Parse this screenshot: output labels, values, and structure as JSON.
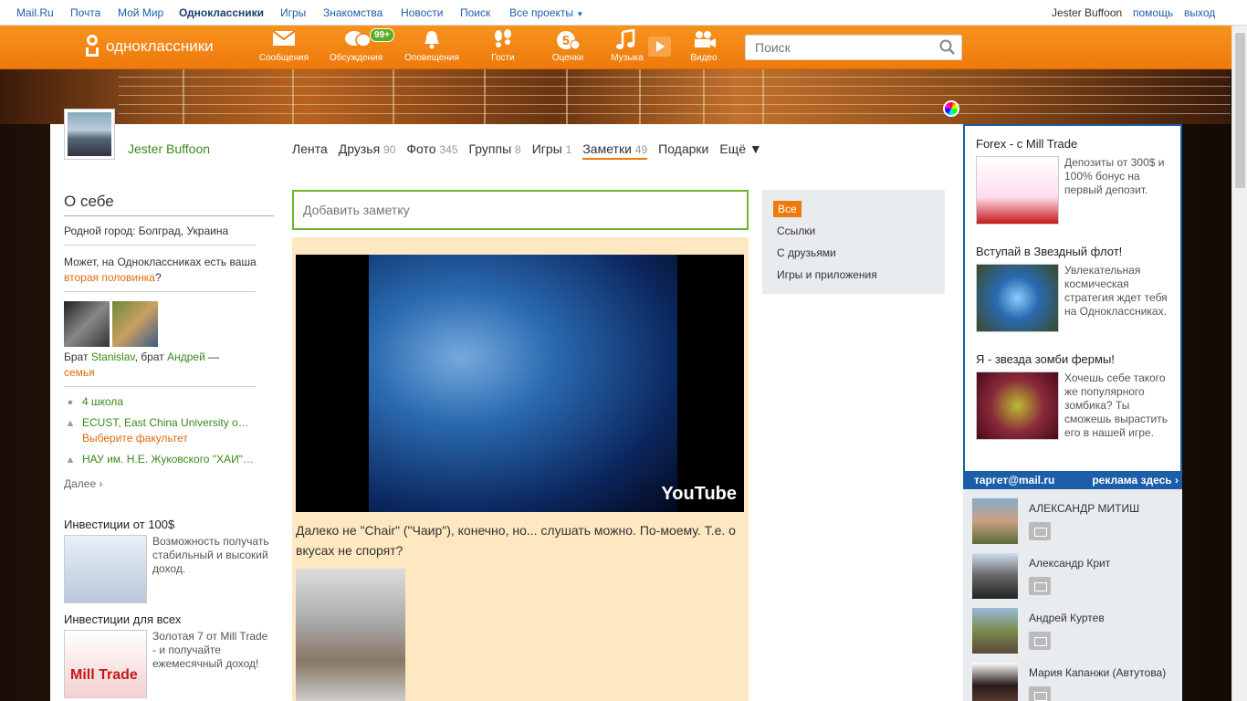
{
  "topbar": {
    "links": [
      "Mail.Ru",
      "Почта",
      "Мой Мир",
      "Одноклассники",
      "Игры",
      "Знакомства",
      "Новости",
      "Поиск",
      "Все проекты"
    ],
    "user": "Jester Buffoon",
    "help": "помощь",
    "logout": "выход"
  },
  "header": {
    "logo": "одноклассники",
    "nav": [
      "Сообщения",
      "Обсуждения",
      "Оповещения",
      "Гости",
      "Оценки",
      "Музыка",
      "Видео"
    ],
    "badge": "99+",
    "search_placeholder": "Поиск"
  },
  "profile": {
    "name": "Jester Buffoon",
    "tabs": [
      {
        "label": "Лента",
        "count": ""
      },
      {
        "label": "Друзья",
        "count": "90"
      },
      {
        "label": "Фото",
        "count": "345"
      },
      {
        "label": "Группы",
        "count": "8"
      },
      {
        "label": "Игры",
        "count": "1"
      },
      {
        "label": "Заметки",
        "count": "49"
      },
      {
        "label": "Подарки",
        "count": ""
      },
      {
        "label": "Ещё ▼",
        "count": ""
      }
    ]
  },
  "about": {
    "title": "О себе",
    "hometown": "Родной город: Болград, Украина",
    "half_text": "Может, на Одноклассниках есть ваша",
    "half_link": "вторая половинка",
    "half_end": "?",
    "relatives_pre": "Брат",
    "rel1": "Stanislav",
    "rel_mid": ", брат",
    "rel2": "Андрей",
    "rel_dash": "—",
    "family": "семья",
    "school1": "4 школа",
    "school2": "ECUST, East China University o…",
    "faculty": "Выберите факультет",
    "school3": "НАУ им. Н.Е. Жуковского \"ХАИ\"…",
    "more": "Далее ›"
  },
  "left_ads": [
    {
      "title": "Инвестиции от 100$",
      "text": "Возможность получать стабильный и высокий доход."
    },
    {
      "title": "Инвестиции для всех",
      "text": "Золотая 7 от Mill Trade - и получайте ежемесячный доход!"
    }
  ],
  "note": {
    "add_placeholder": "Добавить заметку",
    "text": "Далеко не \"Chair\" (\"Чаир\"), конечно, но... слушать можно. По-моему. Т.е. о вкусах не спорят?",
    "video_brand": "YouTube"
  },
  "filters": [
    "Все",
    "Ссылки",
    "С друзьями",
    "Игры и приложения"
  ],
  "right_ads": [
    {
      "title": "Forex - c Mill Trade",
      "text": "Депозиты от 300$ и 100% бонус на первый депозит."
    },
    {
      "title": "Вступай в Звездный флот!",
      "text": "Увлекательная космическая стратегия ждет тебя на Одноклассниках."
    },
    {
      "title": "Я - звезда зомби фермы!",
      "text": "Хочешь себе такого же популярного зомбика? Ты сможешь вырастить его в нашей игре."
    }
  ],
  "target": {
    "left": "таргет@mail.ru",
    "right": "реклама здесь ›"
  },
  "friends": [
    "АЛЕКСАНДР МИТИШ",
    "Александр Крит",
    "Андрей Куртев",
    "Мария Капанжи (Автутова)"
  ],
  "colors": {
    "brand": "#ee7a0c",
    "link": "#1c5fa8",
    "green": "#3a8a1a"
  }
}
